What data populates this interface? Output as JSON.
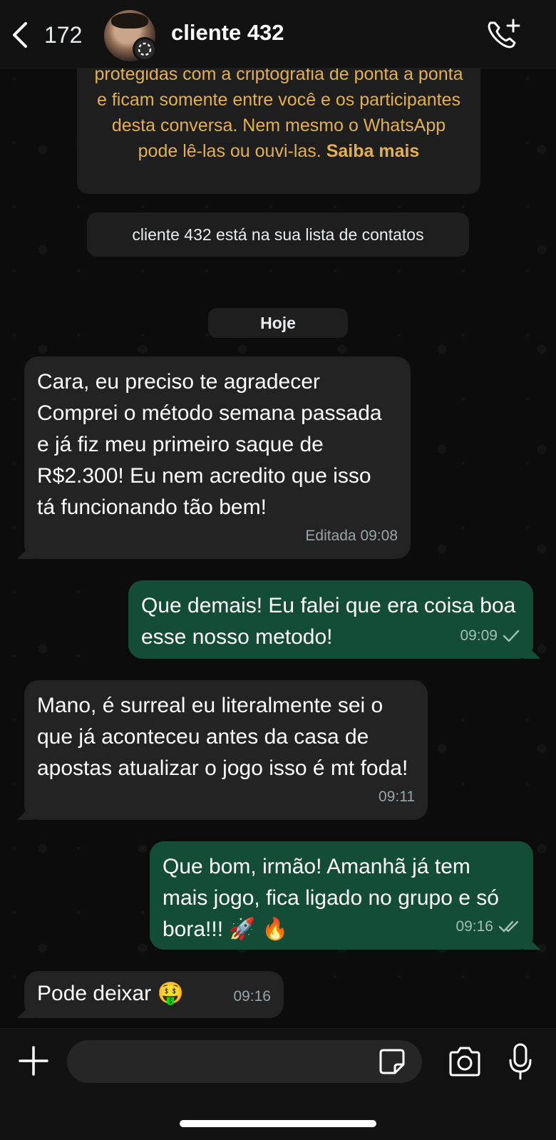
{
  "header": {
    "back_count": "172",
    "contact_name": "cliente 432"
  },
  "system": {
    "encryption_text": "protegidas com a criptografia de ponta a ponta e ficam somente entre você e os participantes desta conversa. Nem mesmo o WhatsApp pode lê-las ou ouvi-las.",
    "encryption_link": "Saiba mais",
    "contact_note": "cliente 432 está na sua lista de contatos",
    "day_label": "Hoje"
  },
  "messages": [
    {
      "direction": "in",
      "text": "Cara, eu preciso te agradecer Comprei o método semana passada e já fiz meu primeiro saque de R$2.300! Eu nem acredito que isso tá funcionando tão bem!",
      "meta": "Editada 09:08"
    },
    {
      "direction": "out",
      "text": "Que demais! Eu falei que era coisa boa esse nosso metodo!",
      "meta": "09:09",
      "status": "sent"
    },
    {
      "direction": "in",
      "text": "Mano, é surreal eu literalmente sei o que já aconteceu antes da casa de apostas atualizar o jogo isso é mt foda!",
      "meta": "09:11"
    },
    {
      "direction": "out",
      "text": "Que bom, irmão! Amanhã já tem mais jogo, fica ligado no grupo e só bora!!! 🚀 🔥",
      "meta": "09:16",
      "status": "delivered"
    },
    {
      "direction": "in",
      "text": "Pode deixar 🤑",
      "meta": "09:16"
    }
  ],
  "input": {
    "placeholder": ""
  },
  "icons": {
    "back": "chevron-left-icon",
    "call": "add-call-icon",
    "plus": "plus-icon",
    "sticker": "sticker-icon",
    "camera": "camera-icon",
    "mic": "microphone-icon"
  },
  "colors": {
    "incoming_bubble": "#232323",
    "outgoing_bubble": "#134d37",
    "system_text": "#e3b04b",
    "background": "#0c0c0c"
  }
}
